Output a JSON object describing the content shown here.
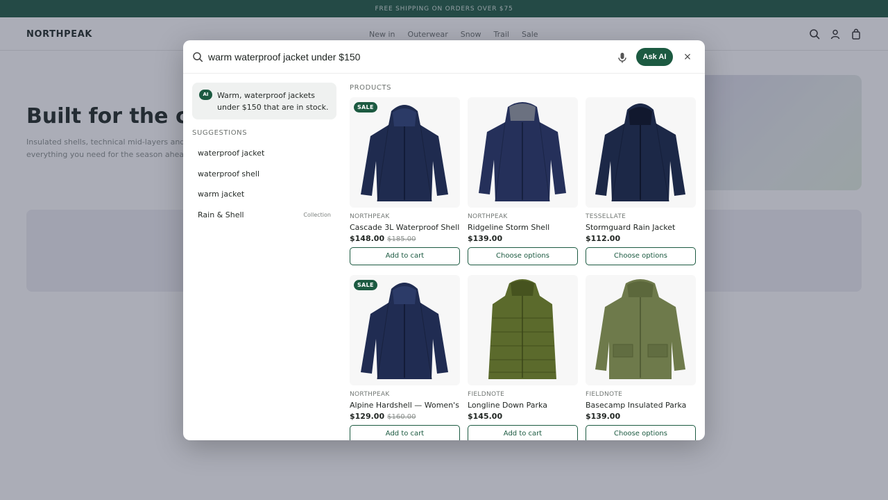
{
  "announcement": "FREE SHIPPING ON ORDERS OVER $75",
  "site": {
    "logo": "NORTHPEAK",
    "nav": [
      "New in",
      "Outerwear",
      "Snow",
      "Trail",
      "Sale"
    ]
  },
  "hero": {
    "title": "Built for the cold",
    "subtitle": "Insulated shells, technical mid-layers and everything you need for the season ahead."
  },
  "search": {
    "query": "warm waterproof jacket under $150",
    "ask_ai_label": "Ask AI",
    "close_label": "×"
  },
  "ai_summary": {
    "badge": "AI",
    "text": "Warm, waterproof jackets under $150 that are in stock."
  },
  "suggestions": {
    "heading": "SUGGESTIONS",
    "items": [
      {
        "label": "waterproof jacket",
        "tag": ""
      },
      {
        "label": "waterproof shell",
        "tag": ""
      },
      {
        "label": "warm jacket",
        "tag": ""
      },
      {
        "label": "Rain & Shell",
        "tag": "Collection"
      }
    ]
  },
  "products": {
    "heading": "PRODUCTS",
    "items": [
      {
        "badge": "SALE",
        "brand": "NORTHPEAK",
        "name": "Cascade 3L Waterproof Shell",
        "price": "$148.00",
        "was": "$185.00",
        "action": "Add to cart",
        "image": "navy-shell-jacket"
      },
      {
        "badge": "",
        "brand": "NORTHPEAK",
        "name": "Ridgeline Storm Shell",
        "price": "$139.00",
        "was": "",
        "action": "Choose options",
        "image": "navy-storm-jacket"
      },
      {
        "badge": "",
        "brand": "TESSELLATE",
        "name": "Stormguard Rain Jacket",
        "price": "$112.00",
        "was": "",
        "action": "Choose options",
        "image": "navy-rain-jacket"
      },
      {
        "badge": "SALE",
        "brand": "NORTHPEAK",
        "name": "Alpine Hardshell — Women's",
        "price": "$129.00",
        "was": "$160.00",
        "action": "Add to cart",
        "image": "navy-hardshell-jacket"
      },
      {
        "badge": "",
        "brand": "FIELDNOTE",
        "name": "Longline Down Parka",
        "price": "$145.00",
        "was": "",
        "action": "Add to cart",
        "image": "olive-down-parka"
      },
      {
        "badge": "",
        "brand": "FIELDNOTE",
        "name": "Basecamp Insulated Parka",
        "price": "$139.00",
        "was": "",
        "action": "Choose options",
        "image": "olive-insulated-parka"
      }
    ]
  },
  "colors": {
    "brand_green": "#1c5a41",
    "navy": "#1f2b4f",
    "olive": "#5b6a2c"
  }
}
